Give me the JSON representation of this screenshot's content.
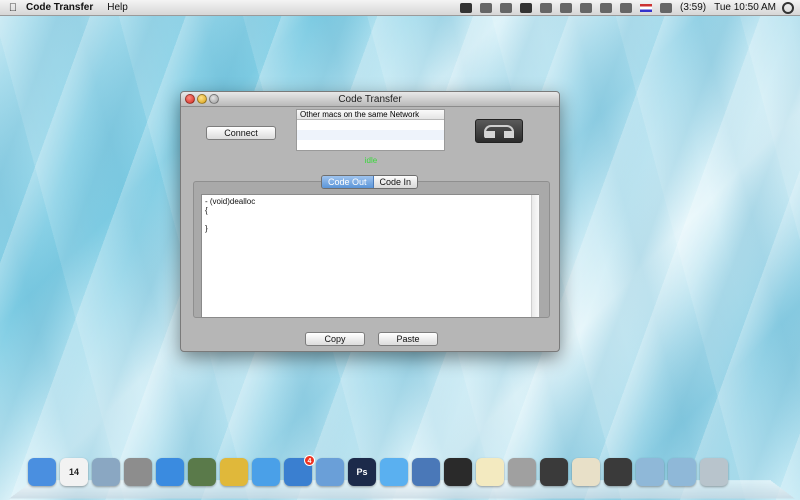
{
  "menubar": {
    "app_name": "Code Transfer",
    "menus": [
      "Help"
    ],
    "battery_text": "(3:59)",
    "clock": "Tue 10:50 AM"
  },
  "window": {
    "title": "Code Transfer",
    "connect_label": "Connect",
    "network_list_header": "Other macs on the same Network",
    "status_text": "idle",
    "tabs": [
      {
        "label": "Code Out",
        "active": true
      },
      {
        "label": "Code In",
        "active": false
      }
    ],
    "code_text": "- (void)dealloc\n{\n\n}",
    "copy_label": "Copy",
    "paste_label": "Paste"
  },
  "dock": {
    "items": [
      {
        "name": "finder-icon",
        "color": "#4a8fe0",
        "label": ""
      },
      {
        "name": "calendar-icon",
        "color": "#f2f2f2",
        "label": "14"
      },
      {
        "name": "mail-icon",
        "color": "#8aa7c2",
        "label": ""
      },
      {
        "name": "system-preferences-icon",
        "color": "#8d8d8d",
        "label": ""
      },
      {
        "name": "itunes-icon",
        "color": "#3a8be0",
        "label": ""
      },
      {
        "name": "iphoto-icon",
        "color": "#5a7a4a",
        "label": ""
      },
      {
        "name": "keychain-icon",
        "color": "#e0b83a",
        "label": ""
      },
      {
        "name": "ichat-icon",
        "color": "#4aa0e8",
        "label": ""
      },
      {
        "name": "app-store-icon",
        "color": "#3a7fd0",
        "label": "",
        "badge": "4"
      },
      {
        "name": "preview-icon",
        "color": "#6a9fd8",
        "label": ""
      },
      {
        "name": "photoshop-icon",
        "color": "#1c2a4a",
        "label": "Ps"
      },
      {
        "name": "safari-icon",
        "color": "#5ab0f0",
        "label": ""
      },
      {
        "name": "xcode-icon",
        "color": "#4a78b8",
        "label": ""
      },
      {
        "name": "ios-simulator-icon",
        "color": "#2a2a2a",
        "label": ""
      },
      {
        "name": "textedit-icon",
        "color": "#f3eac0",
        "label": ""
      },
      {
        "name": "audio-icon",
        "color": "#a0a0a0",
        "label": ""
      },
      {
        "name": "imovie-icon",
        "color": "#3a3a3a",
        "label": ""
      },
      {
        "name": "script-icon",
        "color": "#e8e0c8",
        "label": ""
      },
      {
        "name": "code-transfer-icon",
        "color": "#3a3a3a",
        "label": ""
      },
      {
        "name": "applications-folder-icon",
        "color": "#8fb8d8",
        "label": ""
      },
      {
        "name": "documents-folder-icon",
        "color": "#8fb8d8",
        "label": ""
      },
      {
        "name": "trash-icon",
        "color": "#b8c4cc",
        "label": ""
      }
    ]
  }
}
